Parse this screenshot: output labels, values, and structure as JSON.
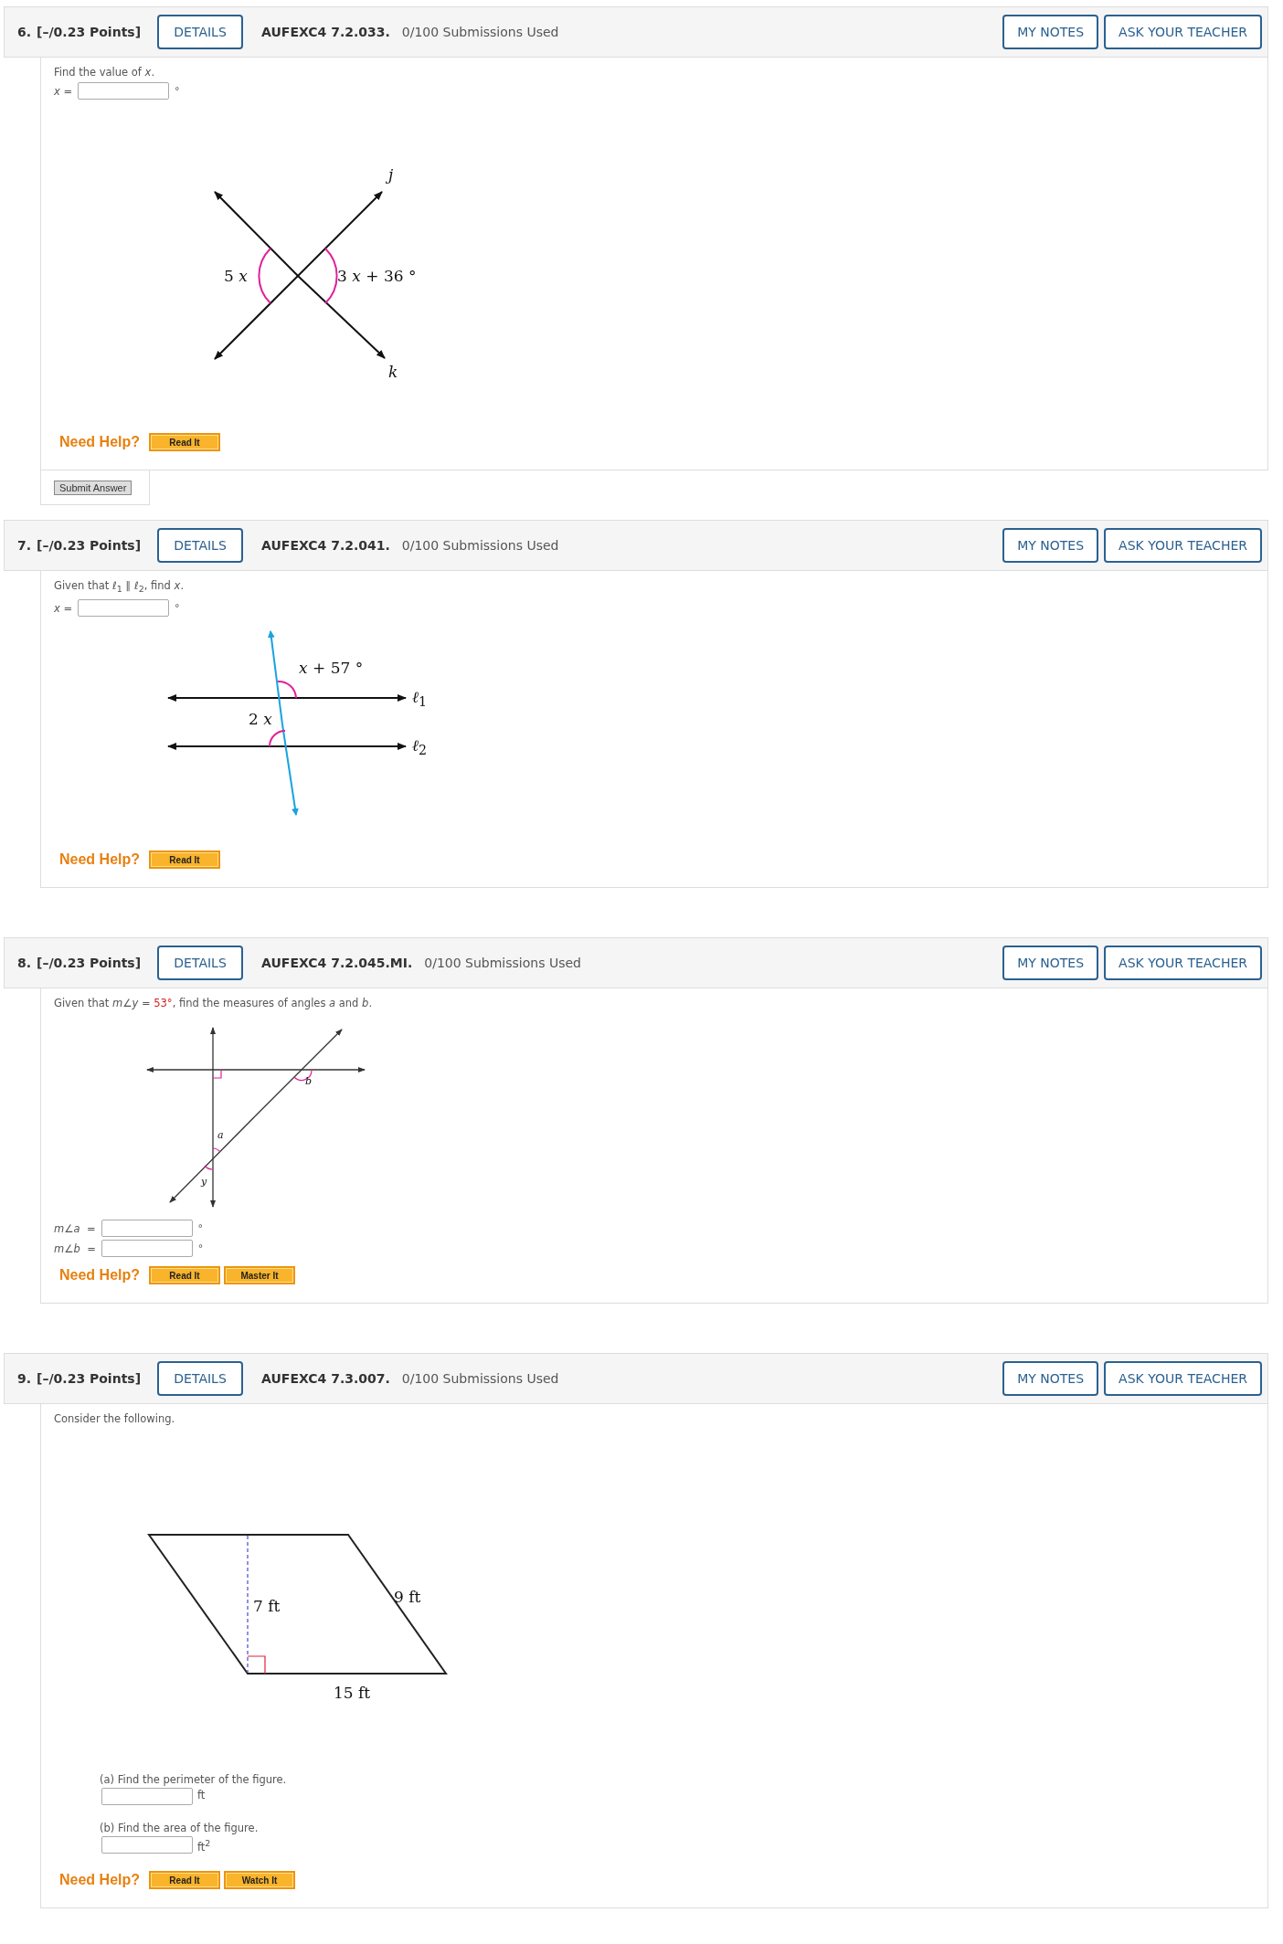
{
  "questions": [
    {
      "number": "6.",
      "points": "[–/0.23 Points]",
      "details_button": "DETAILS",
      "code": "AUFEXC4 7.2.033.",
      "submissions": "0/100 Submissions Used",
      "notes_button": "MY NOTES",
      "teacher_button": "ASK YOUR TEACHER",
      "blocks": [
        {
          "kind": "text",
          "parts": [
            {
              "text": "Find the value of *x*."
            }
          ]
        },
        {
          "kind": "inline-answer",
          "label": "*x* =",
          "unit": "°"
        },
        {
          "kind": "crossing-lines-figure",
          "labels": [
            "5 *x*",
            "3 *x* + 36 °",
            "*j*",
            "*k*"
          ]
        }
      ],
      "help_label": "Need Help?",
      "help_buttons": [
        "Read It"
      ],
      "submit_button": "Submit Answer"
    },
    {
      "number": "7.",
      "points": "[–/0.23 Points]",
      "details_button": "DETAILS",
      "code": "AUFEXC4 7.2.041.",
      "submissions": "0/100 Submissions Used",
      "notes_button": "MY NOTES",
      "teacher_button": "ASK YOUR TEACHER",
      "blocks": [
        {
          "kind": "text",
          "parts": [
            {
              "text": "Given that *ℓ*$_{1}$ ∥ *ℓ*$_{2}$, find *x*."
            }
          ]
        },
        {
          "kind": "inline-answer",
          "label": "*x* =",
          "unit": "°"
        },
        {
          "kind": "parallel-lines-figure",
          "labels": [
            "*x* + 57 °",
            "2 *x*",
            "*ℓ*$_{1}$",
            "*ℓ*$_{2}$"
          ]
        }
      ],
      "help_label": "Need Help?",
      "help_buttons": [
        "Read It"
      ]
    },
    {
      "number": "8.",
      "points": "[–/0.23 Points]",
      "details_button": "DETAILS",
      "code": "AUFEXC4 7.2.045.MI.",
      "submissions": "0/100 Submissions Used",
      "notes_button": "MY NOTES",
      "teacher_button": "ASK YOUR TEACHER",
      "blocks": [
        {
          "kind": "text",
          "parts": [
            {
              "text": "Given that *m*∠*y* = "
            },
            {
              "text": "53°",
              "kind": "given"
            },
            {
              "text": ", find the measures of angles *a* and *b*."
            }
          ]
        },
        {
          "kind": "transversal-figure",
          "labels": [
            "*b*",
            "*a*",
            "*y*"
          ]
        },
        {
          "kind": "inline-answer",
          "label": "*m*∠*a*  =",
          "unit": "°"
        },
        {
          "kind": "inline-answer",
          "label": "*m*∠*b*  =",
          "unit": "°"
        }
      ],
      "help_label": "Need Help?",
      "help_buttons": [
        "Read It",
        "Master It"
      ]
    },
    {
      "number": "9.",
      "points": "[–/0.23 Points]",
      "details_button": "DETAILS",
      "code": "AUFEXC4 7.3.007.",
      "submissions": "0/100 Submissions Used",
      "notes_button": "MY NOTES",
      "teacher_button": "ASK YOUR TEACHER",
      "blocks": [
        {
          "kind": "text",
          "parts": [
            {
              "text": "Consider the following."
            }
          ]
        },
        {
          "kind": "parallelogram-figure",
          "labels": [
            "7 ft",
            "9 ft",
            "15 ft"
          ]
        },
        {
          "kind": "part-answer",
          "prompt": "(a) Find the perimeter of the figure.",
          "unit": "ft"
        },
        {
          "kind": "part-answer",
          "prompt": "(b) Find the area of the figure.",
          "unit": "ft$^{2}$"
        }
      ],
      "help_label": "Need Help?",
      "help_buttons": [
        "Read It",
        "Watch It"
      ]
    }
  ]
}
